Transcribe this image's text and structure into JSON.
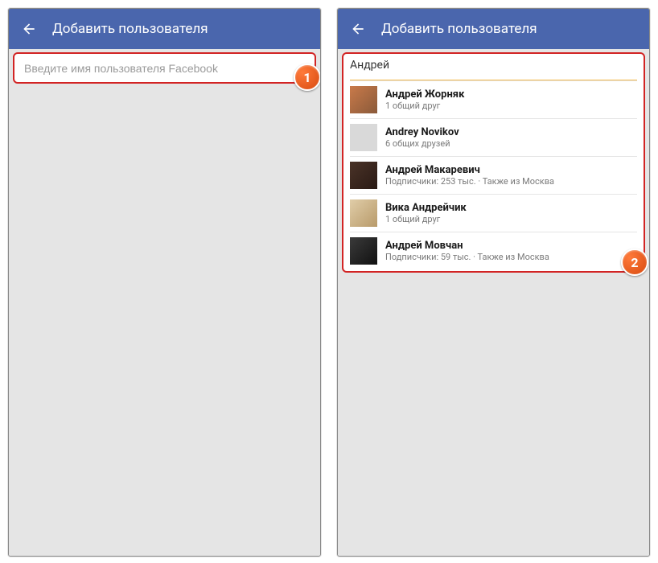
{
  "header": {
    "title": "Добавить пользователя"
  },
  "search": {
    "placeholder": "Введите имя пользователя Facebook",
    "value": "Андрей"
  },
  "badges": {
    "one": "1",
    "two": "2"
  },
  "results": [
    {
      "name": "Андрей Жорняк",
      "sub": "1 общий друг"
    },
    {
      "name": "Andrey Novikov",
      "sub": "6 общих друзей"
    },
    {
      "name": "Андрей Макаревич",
      "sub": "Подписчики: 253 тыс. · Также из Москва"
    },
    {
      "name": "Вика Андрейчик",
      "sub": "1 общий друг"
    },
    {
      "name": "Андрей Мовчан",
      "sub": "Подписчики: 59 тыс. · Также из Москва"
    }
  ]
}
